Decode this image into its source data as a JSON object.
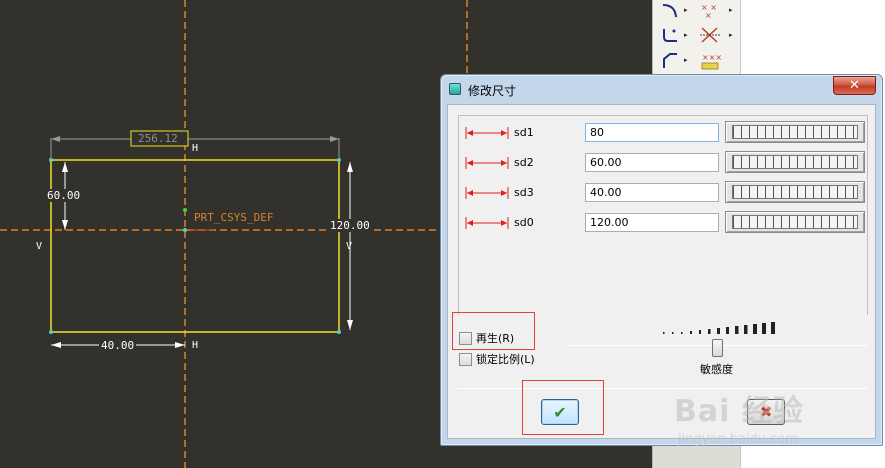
{
  "canvas": {
    "dimensions": {
      "top_ref": "256.12",
      "left_height": "60.00",
      "right_height": "120.00",
      "bottom_width": "40.00"
    },
    "coord_label": "PRT_CSYS_DEF",
    "markers": {
      "h": "H",
      "v": "V"
    }
  },
  "toolbar": {
    "icons": [
      "arc-icon",
      "trim-x-icon",
      "fillet-icon",
      "mirror-x-icon",
      "chamfer-icon",
      "dimension-icon"
    ]
  },
  "dialog": {
    "title": "修改尺寸",
    "close_symbol": "✕",
    "dimensions": [
      {
        "label": "sd1",
        "value": "80"
      },
      {
        "label": "sd2",
        "value": "60.00"
      },
      {
        "label": "sd3",
        "value": "40.00"
      },
      {
        "label": "sd0",
        "value": "120.00"
      }
    ],
    "regenerate_label": "再生(R)",
    "lock_scale_label": "锁定比例(L)",
    "sensitivity_label": "敏感度",
    "ok_symbol": "✔",
    "cancel_symbol": "✖"
  },
  "watermark": {
    "text": "Bai 经验",
    "url": "jingyan.baidu.com"
  },
  "colors": {
    "sketch_line": "#f2e12a",
    "centerline": "#d9822b",
    "highlight": "#e0433a",
    "ok_check": "#2e8b2e",
    "cancel_x": "#c0392b"
  }
}
